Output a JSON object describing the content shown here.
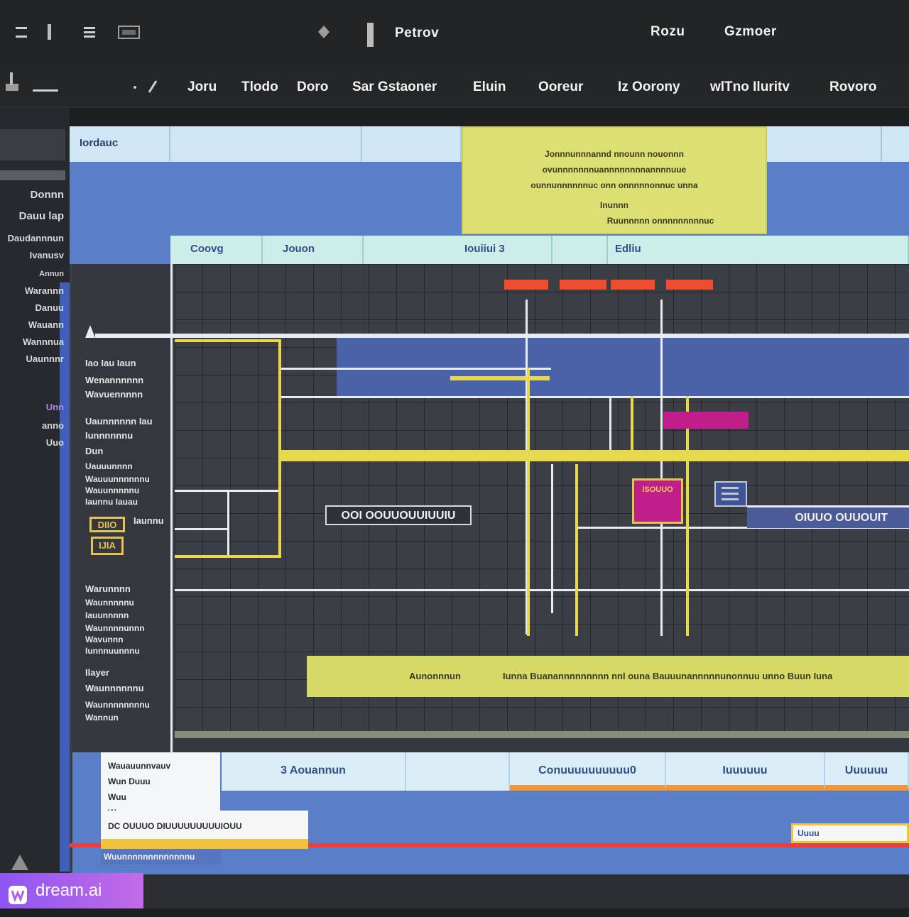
{
  "topbar": {
    "title": "Petrov",
    "right_items": [
      "Rozu",
      "Gzmoer"
    ]
  },
  "menubar": {
    "items": [
      "Joru",
      "Tlodo",
      "Doro",
      "Sar Gstaoner",
      "Eluin",
      "Ooreur",
      "Iz Oorony",
      "wlTno Iluritv",
      "Rovoro"
    ]
  },
  "left_panel": {
    "labels": [
      "Donnn",
      "Dauu lap",
      "Daudannnun",
      "Ivanusv",
      "Annun",
      "Warannn",
      "Danuu",
      "Wauann",
      "Wannnua",
      "Uaunnnr",
      "Unn",
      "anno",
      "Uuo"
    ]
  },
  "grid": {
    "header_cells": [
      "Iordauc",
      "",
      "",
      "",
      "",
      ""
    ],
    "top_note": {
      "lines": [
        "Jonnnunnnannd nnounn nouonnn",
        "ovunnnnnnnuannnnnnnnannnnuue",
        "ounnunnnnnnuc onn onnnnnonnuc unna",
        "Inunnn",
        "Ruunnnnn onnnnnnnnnuc"
      ]
    },
    "teal_header": [
      "Coovg",
      "Jouon",
      "Iouiiui 3",
      "",
      "Edliu"
    ],
    "side_labels": [
      "Iao Iau Iaun",
      "Wenannnnnn",
      "Wavuennnnn",
      "Uaunnnnnn Iau",
      "Iunnnnnnu",
      "Dun",
      "Uauuunnnn",
      "Wauuunnnnnnu",
      "Wauunnnnnu",
      "Iaunnu Iauau",
      "Iaunnu",
      "Warunnnn",
      "Waunnnnnu",
      "Iauunnnnn",
      "Waunnnnunnn",
      "Wavunnn",
      "Iunnnuunnnu",
      "Ilayer",
      "Waunnnnnnu",
      "Waunnnnnnnnu",
      "Wannun"
    ],
    "tags": [
      "DIIO",
      "IJIA"
    ],
    "row_labels": [
      "OOI OOUUOUUIUUIU",
      "OIUUO OUUOUIT"
    ],
    "mag_label": "ISOUUO",
    "wide_note": {
      "left": "Aunonnnun",
      "right": "Iunna Buanannnnnnnnn nnl ouna Bauuunannnnnunonnuu unno Buun Iuna"
    }
  },
  "bottom": {
    "note_lines": [
      "Wauauunnvauv",
      "Wun Duuu",
      "Wuu",
      "Wuu unnnnnunnuuou",
      "DC OUUUO DIUUUUUUUUUIOUU"
    ],
    "cells": [
      "3 Aouannun",
      "",
      "Conuuuuuuuuuu0",
      "Iuuuuuu",
      "Uuuuuu"
    ],
    "small_tag": "Uuuu",
    "footer_text": "Wuunnnnnnnnnnnnnu"
  },
  "watermark": {
    "brand": "dream.ai"
  },
  "colors": {
    "accent_yellow": "#e8d84e",
    "accent_red": "#ef4d2e",
    "accent_magenta": "#c21e8b",
    "band_blue": "#5a7fc8",
    "header_light": "#cfe6f5"
  }
}
